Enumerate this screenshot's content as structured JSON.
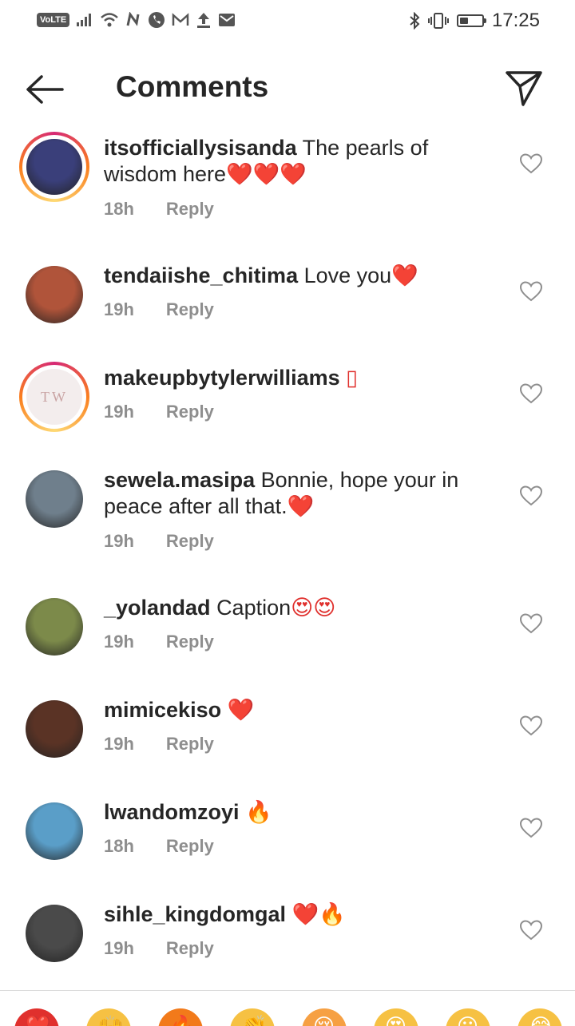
{
  "status_bar": {
    "volte": "VoLTE",
    "time": "17:25",
    "icons": [
      "signal-icon",
      "wifi-icon",
      "n-icon",
      "phone-icon",
      "mail-icon",
      "upload-icon",
      "message-icon",
      "bluetooth-icon",
      "vibrate-icon",
      "battery-icon"
    ],
    "battery_level": 0.4
  },
  "header": {
    "title": "Comments",
    "back_icon": "back-arrow-icon",
    "send_icon": "paper-plane-icon"
  },
  "comments": [
    {
      "user": "itsofficiallysisanda",
      "text": "The pearls of wisdom here",
      "emoji": "❤️❤️❤️",
      "time": "18h",
      "reply": "Reply",
      "story_ring": true,
      "avatar_color": "#3a3f7a"
    },
    {
      "user": "tendaiishe_chitima",
      "text": "Love you",
      "emoji": "❤️",
      "time": "19h",
      "reply": "Reply",
      "story_ring": false,
      "avatar_color": "#b0543a"
    },
    {
      "user": "makeupbytylerwilliams",
      "text": "",
      "emoji": "▯",
      "time": "19h",
      "reply": "Reply",
      "story_ring": true,
      "avatar_color": "#f3eded",
      "avatar_text": "TW"
    },
    {
      "user": "sewela.masipa",
      "text": "Bonnie,  hope your in peace after all that.",
      "emoji": "❤️",
      "time": "19h",
      "reply": "Reply",
      "story_ring": false,
      "avatar_color": "#6f7f8c"
    },
    {
      "user": "_yolandad",
      "text": "Caption",
      "emoji": "😍😍",
      "time": "19h",
      "reply": "Reply",
      "story_ring": false,
      "avatar_color": "#7c8a4a"
    },
    {
      "user": "mimicekiso",
      "text": "",
      "emoji": "❤️",
      "time": "19h",
      "reply": "Reply",
      "story_ring": false,
      "avatar_color": "#5a3325"
    },
    {
      "user": "lwandomzoyi",
      "text": "",
      "emoji": "🔥",
      "time": "18h",
      "reply": "Reply",
      "story_ring": false,
      "avatar_color": "#5a9ec8"
    },
    {
      "user": "sihle_kingdomgal",
      "text": "",
      "emoji": "❤️🔥",
      "time": "19h",
      "reply": "Reply",
      "story_ring": false,
      "avatar_color": "#4a4a4a"
    }
  ],
  "emoji_bar": {
    "items": [
      "❤️",
      "🙌",
      "🔥",
      "👏",
      "😢",
      "😍",
      "😮",
      "😂"
    ],
    "colors": [
      "#e0302d",
      "#f6c143",
      "#f27a1a",
      "#f6c143",
      "#f6a043",
      "#f6c143",
      "#f6c143",
      "#f6c143"
    ]
  }
}
